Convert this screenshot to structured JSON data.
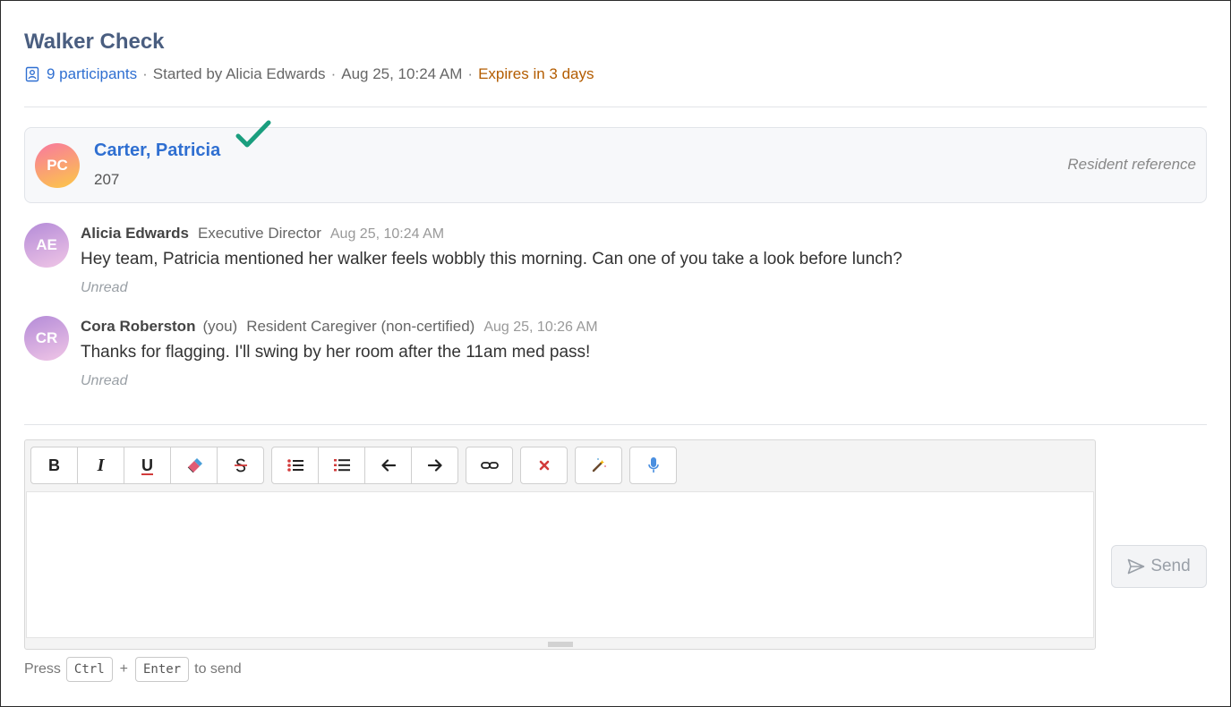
{
  "thread": {
    "title": "Walker Check",
    "participants_label": "9 participants",
    "started_by": "Started by Alicia Edwards",
    "started_at": "Aug 25, 10:24 AM",
    "expires": "Expires in 3 days",
    "separator": "·"
  },
  "resident": {
    "initials": "PC",
    "name": "Carter, Patricia",
    "room": "207",
    "reference_label": "Resident reference",
    "status_icon": "checkmark-icon"
  },
  "messages": [
    {
      "initials": "AE",
      "sender": "Alicia Edwards",
      "you_label": "",
      "role": "Executive Director",
      "time": "Aug 25, 10:24 AM",
      "body": "Hey team, Patricia mentioned her walker feels wobbly this morning. Can one of you take a look before lunch?",
      "status": "Unread"
    },
    {
      "initials": "CR",
      "sender": "Cora Roberston",
      "you_label": "(you)",
      "role": "Resident Caregiver (non-certified)",
      "time": "Aug 25, 10:26 AM",
      "body": "Thanks for flagging. I'll swing by her room after the 11am med pass!",
      "status": "Unread"
    }
  ],
  "editor": {
    "toolbar": {
      "bold": "B",
      "italic": "I",
      "underline": "U",
      "icons": [
        "bold-icon",
        "italic-icon",
        "underline-icon",
        "eraser-icon",
        "strikethrough-icon",
        "bulleted-list-icon",
        "numbered-list-icon",
        "outdent-arrow-icon",
        "indent-arrow-icon",
        "link-icon",
        "remove-format-icon",
        "magic-wand-icon",
        "microphone-icon"
      ]
    },
    "value": ""
  },
  "send": {
    "label": "Send",
    "icon": "paper-plane-icon"
  },
  "hint": {
    "press": "Press",
    "key1": "Ctrl",
    "plus": "+",
    "key2": "Enter",
    "suffix": "to send"
  },
  "colors": {
    "accent": "#2f6fd1",
    "title": "#4a5e80",
    "expires": "#b35c00",
    "check": "#1a9e7e"
  }
}
